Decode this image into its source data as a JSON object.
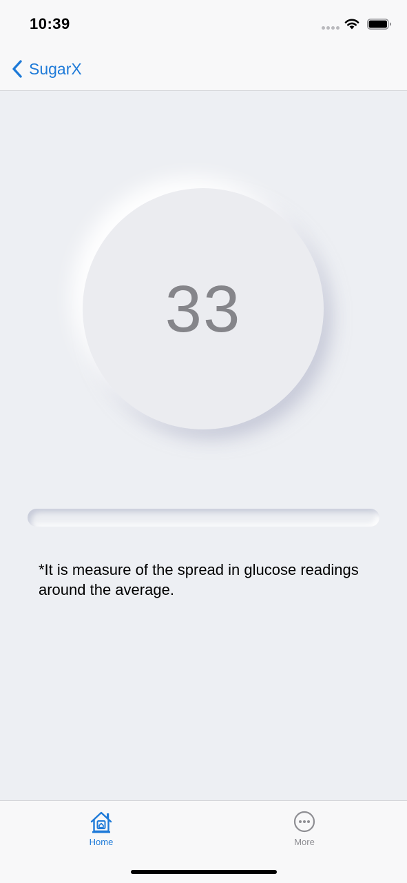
{
  "status_bar": {
    "time": "10:39",
    "icons": [
      "signal-dots-icon",
      "wifi-icon",
      "battery-icon"
    ]
  },
  "nav": {
    "back_label": "SugarX",
    "back_icon": "chevron-left-icon"
  },
  "metric": {
    "value": "33"
  },
  "progress": {
    "fraction": 0
  },
  "note": {
    "text": "*It is measure of the spread in glucose readings around the average."
  },
  "tabs": [
    {
      "label": "Home",
      "icon": "home-icon",
      "active": true
    },
    {
      "label": "More",
      "icon": "more-icon",
      "active": false
    }
  ],
  "colors": {
    "accent": "#1e7ad8",
    "background": "#edeff3",
    "value_text": "#85858a",
    "inactive_tab": "#8e8e93"
  }
}
